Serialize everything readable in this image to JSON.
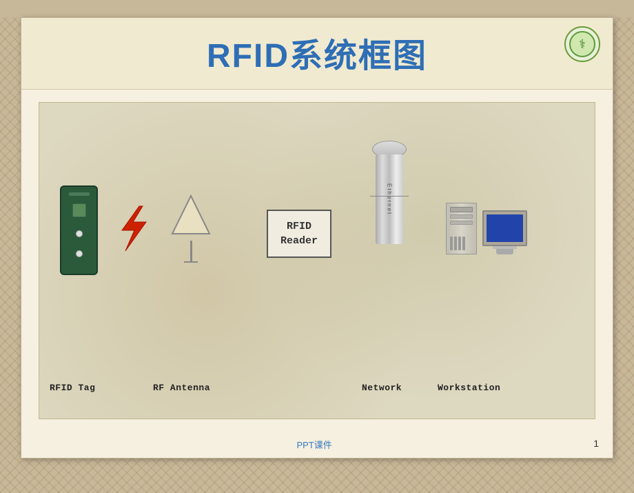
{
  "slide": {
    "title": "RFID系统框图",
    "background_color": "#c8b89a",
    "slide_bg": "#f5f0e0",
    "diagram_bg": "#ddd8c0"
  },
  "components": {
    "rfid_tag": {
      "label": "RFID Tag",
      "color": "#2a5a3a"
    },
    "rf_antenna": {
      "label": "RF Antenna"
    },
    "rfid_reader": {
      "label_line1": "RFID",
      "label_line2": "Reader"
    },
    "network": {
      "label": "Network",
      "ethernet_text": "Ethernet"
    },
    "workstation": {
      "label": "Workstation"
    }
  },
  "footer": {
    "ppt_label": "PPT课件",
    "page_number": "1"
  },
  "logo": {
    "symbol": "⚕"
  }
}
